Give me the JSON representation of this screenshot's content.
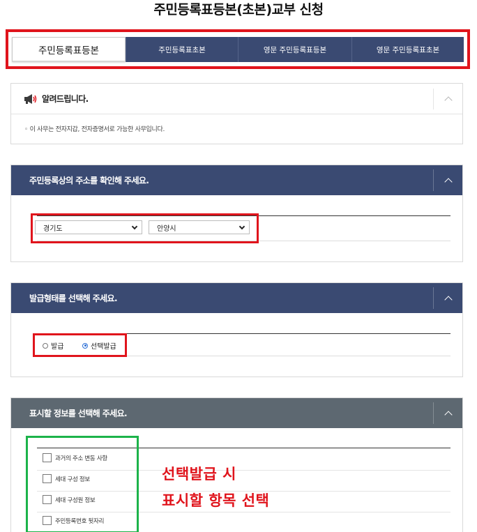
{
  "page_title": "주민등록표등본(초본)교부 신청",
  "tabs": [
    {
      "label": "주민등록표등본",
      "active": true
    },
    {
      "label": "주민등록표초본",
      "active": false
    },
    {
      "label": "영문 주민등록표등본",
      "active": false
    },
    {
      "label": "영문 주민등록표초본",
      "active": false
    }
  ],
  "notice": {
    "title": "알려드립니다.",
    "text": "◦ 이 사무는 전자지갑, 전자증명서로 가능한 사무입니다."
  },
  "address": {
    "title": "주민등록상의 주소를 확인해 주세요.",
    "province": "경기도",
    "city": "안양시"
  },
  "issue_type": {
    "title": "발급형태를 선택해 주세요.",
    "options": [
      {
        "label": "발급",
        "selected": false
      },
      {
        "label": "선택발급",
        "selected": true
      }
    ]
  },
  "display_info": {
    "title": "표시할 정보를 선택해 주세요.",
    "items": [
      "과거의 주소 변동 사항",
      "세대 구성 정보",
      "세대 구성원 정보",
      "주민등록번호 뒷자리"
    ]
  },
  "annotation": {
    "line1": "선택발급 시",
    "line2": "표시할 항목 선택"
  },
  "colors": {
    "navy": "#3a4a72",
    "gray_header": "#5d6871",
    "highlight_red": "#e0141c",
    "highlight_green": "#1cb34a"
  }
}
